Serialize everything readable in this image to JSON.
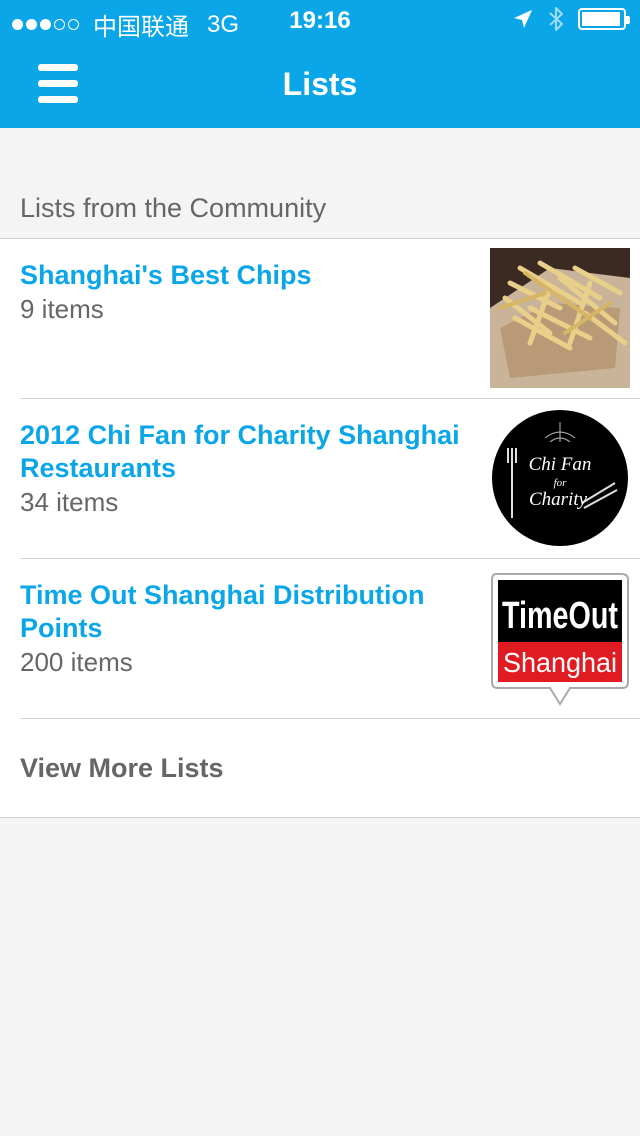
{
  "status_bar": {
    "carrier": "中国联通",
    "network": "3G",
    "time": "19:16",
    "signal_filled": 3,
    "signal_total": 5,
    "battery_level_fraction": 0.9
  },
  "nav": {
    "title": "Lists",
    "menu_icon": "hamburger-menu-icon",
    "bar_color": "#0aa6e8"
  },
  "section": {
    "header": "Lists from the Community"
  },
  "lists": [
    {
      "title": "Shanghai's Best Chips",
      "count": "9 items",
      "thumb": "fries-photo"
    },
    {
      "title": "2012 Chi Fan for Charity Shanghai Restaurants",
      "count": "34 items",
      "thumb": "chi-fan-for-charity-logo",
      "logo_text": [
        "Chi Fan",
        "for",
        "Charity"
      ]
    },
    {
      "title": "Time Out Shanghai Distribution Points",
      "count": "200 items",
      "thumb": "time-out-shanghai-logo",
      "logo_text": [
        "TimeOut",
        "Shanghai"
      ]
    }
  ],
  "more": {
    "label": "View More Lists"
  },
  "colors": {
    "accent": "#0aa6e8",
    "background": "#f4f4f4",
    "secondary_text": "#666666"
  }
}
